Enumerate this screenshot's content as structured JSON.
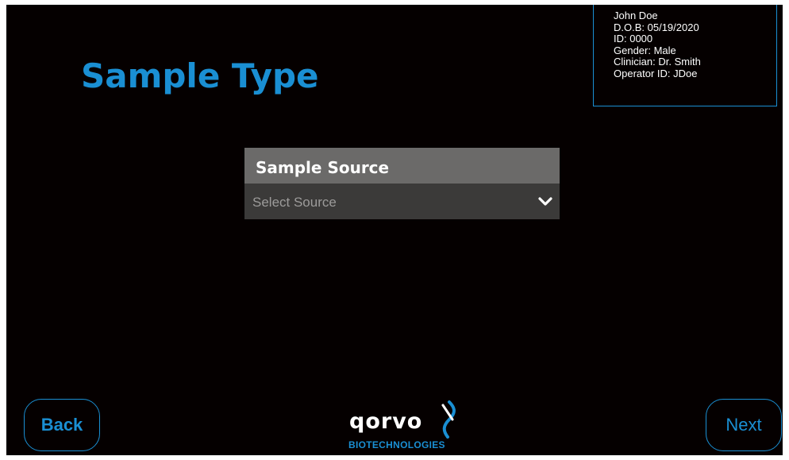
{
  "page": {
    "title": "Sample Type"
  },
  "patient": {
    "name": "John Doe",
    "dob": "D.O.B: 05/19/2020",
    "id": "ID: 0000",
    "gender": "Gender: Male",
    "clinician": "Clinician: Dr. Smith",
    "operator": "Operator ID: JDoe"
  },
  "sample_source": {
    "header": "Sample Source",
    "placeholder": "Select Source",
    "selected_value": "",
    "icon": "chevron-down-icon"
  },
  "navigation": {
    "back_label": "Back",
    "next_label": "Next"
  },
  "logo": {
    "wordmark": "qorvo",
    "subtitle": "BIOTECHNOLOGIES"
  },
  "colors": {
    "accent": "#1a8fd3",
    "background": "#050000",
    "panel_header": "#6b6a69",
    "panel_field": "#3b3a39",
    "placeholder_text": "#9c9b9a",
    "text": "#ffffff"
  }
}
